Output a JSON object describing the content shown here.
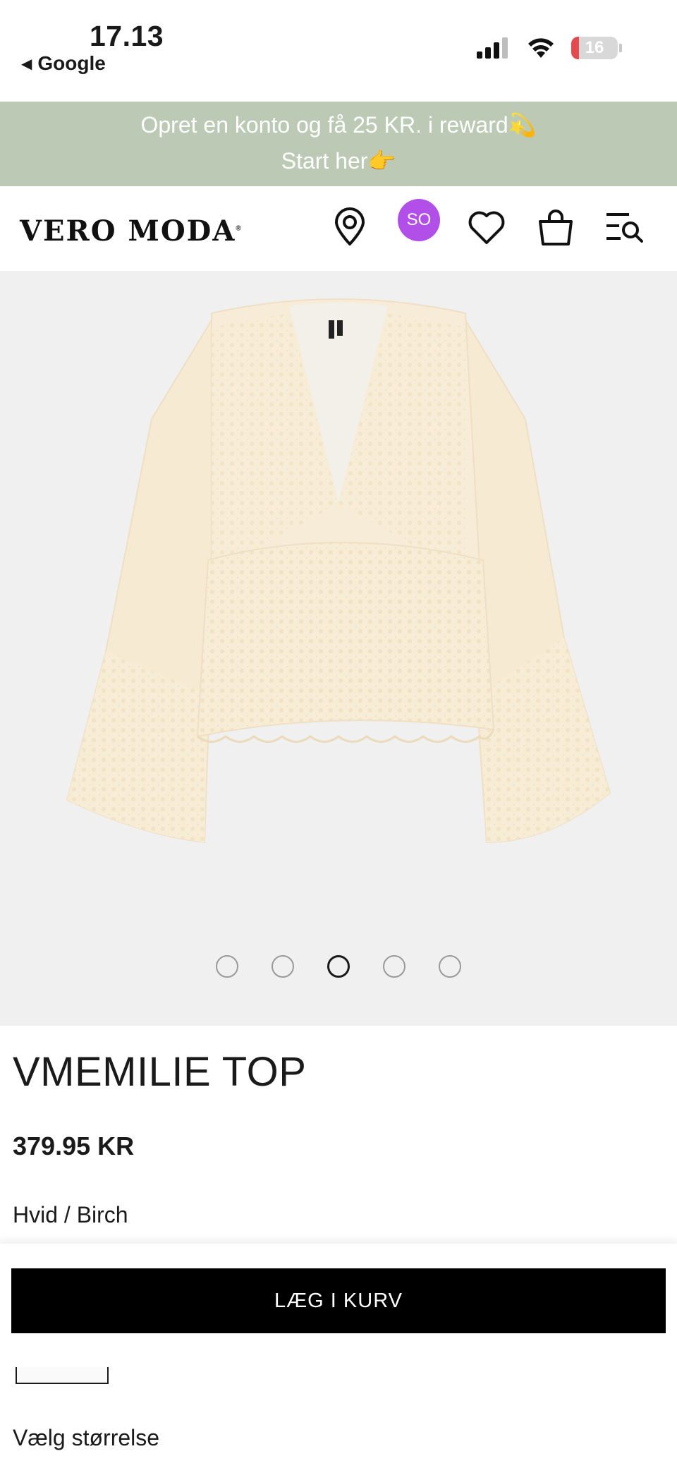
{
  "status_bar": {
    "time": "17.13",
    "back_app": "Google",
    "battery": "16",
    "battery_level": 0.16
  },
  "promo": {
    "line1": "Opret en konto og få 25 KR. i reward💫",
    "line2": "Start her👉"
  },
  "header": {
    "logo": "VERO MODA",
    "logo_mark": "®",
    "avatar_initials": "SO",
    "icons": [
      "location-pin-icon",
      "heart-icon",
      "shopping-bag-icon",
      "search-menu-icon"
    ]
  },
  "gallery": {
    "image_count": 5,
    "active_index": 2
  },
  "product": {
    "title": "VMEMILIE TOP",
    "price": "379.95 KR",
    "color": "Hvid / Birch",
    "add_to_cart": "LÆG I KURV",
    "size_label": "Vælg størrelse"
  },
  "colors": {
    "promo_bg": "#bccab5",
    "avatar_bg": "#b24fe8",
    "gallery_bg": "#f0f0f0",
    "button_bg": "#000000"
  }
}
